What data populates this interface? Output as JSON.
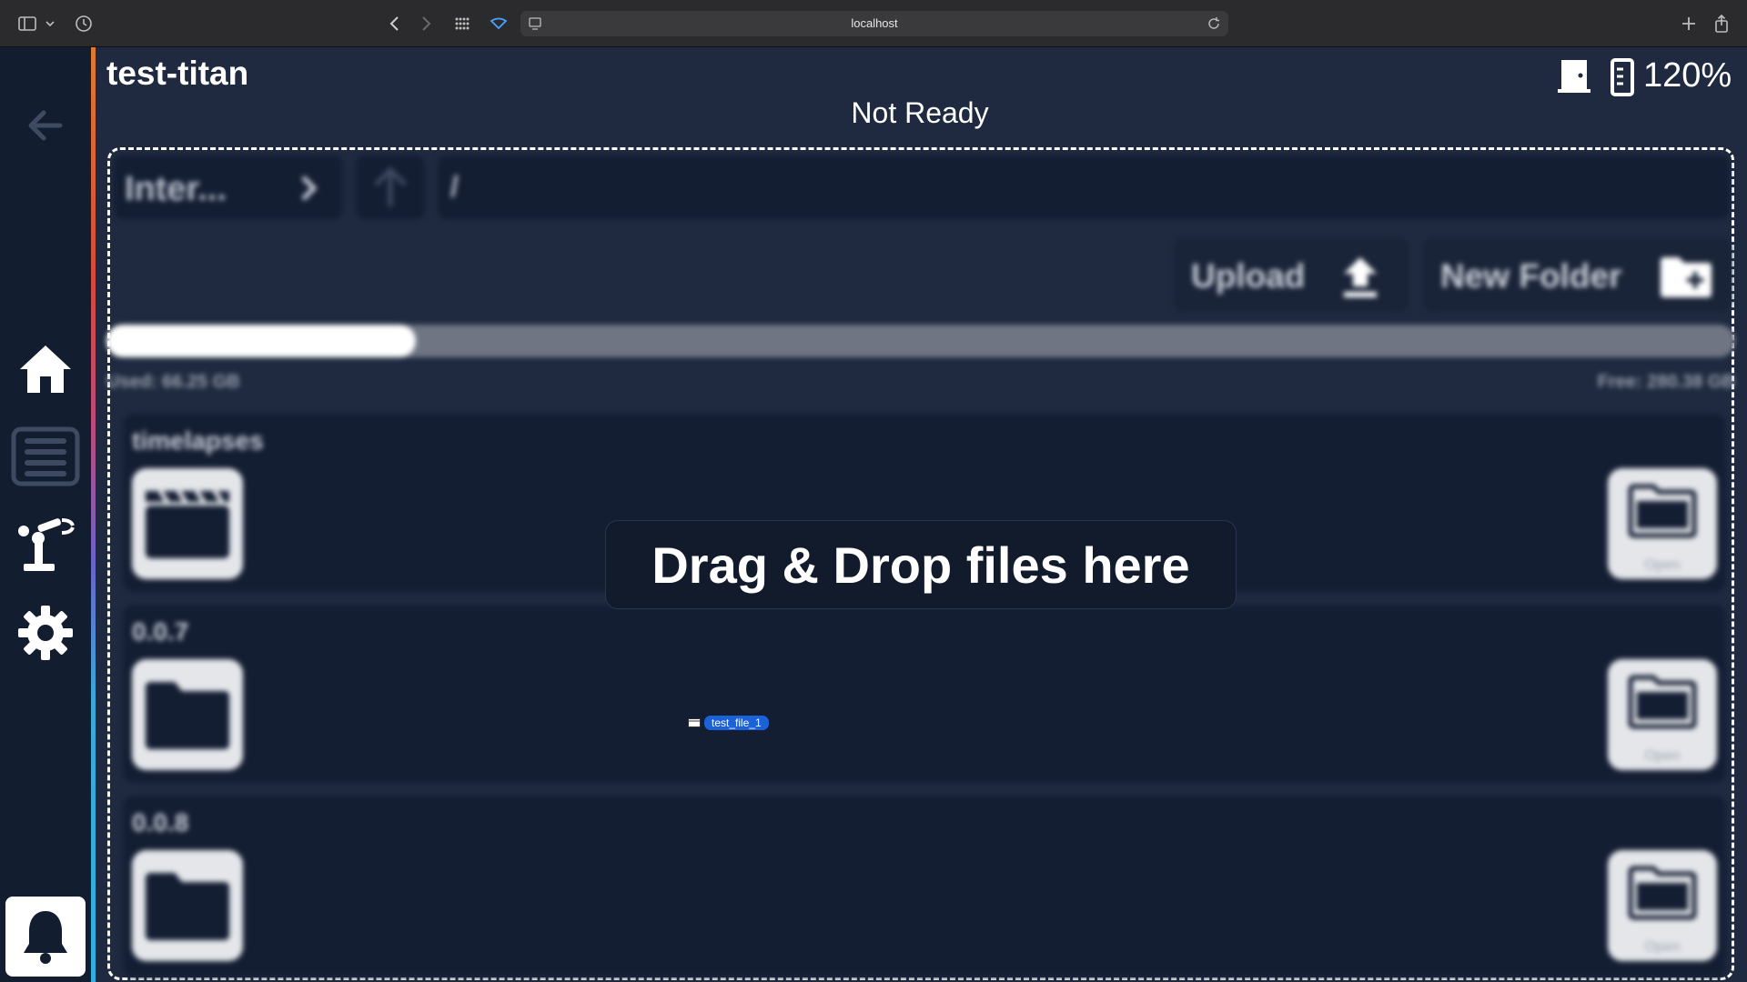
{
  "browser": {
    "url": "localhost"
  },
  "sidebar": {
    "items": [
      {
        "name": "back-arrow-icon"
      },
      {
        "name": "home-icon"
      },
      {
        "name": "list-icon"
      },
      {
        "name": "robot-arm-icon"
      },
      {
        "name": "gear-icon"
      },
      {
        "name": "bell-icon"
      }
    ]
  },
  "header": {
    "title": "test-titan",
    "status": "Not Ready",
    "zoom": "120%"
  },
  "file_manager": {
    "storage_label": "Inter...",
    "path": "/",
    "upload_label": "Upload",
    "new_folder_label": "New Folder",
    "used_label": "Used: 66.25 GB",
    "free_label": "Free: 280.38 GB",
    "used_fraction": 0.19,
    "rows": [
      {
        "name": "timelapses",
        "icon": "clapperboard-icon",
        "open_label": "Open"
      },
      {
        "name": "0.0.7",
        "icon": "folder-icon",
        "open_label": "Open"
      },
      {
        "name": "0.0.8",
        "icon": "folder-icon",
        "open_label": "Open"
      }
    ]
  },
  "overlay": {
    "message": "Drag & Drop files here",
    "dragged_file": "test_file_1"
  }
}
